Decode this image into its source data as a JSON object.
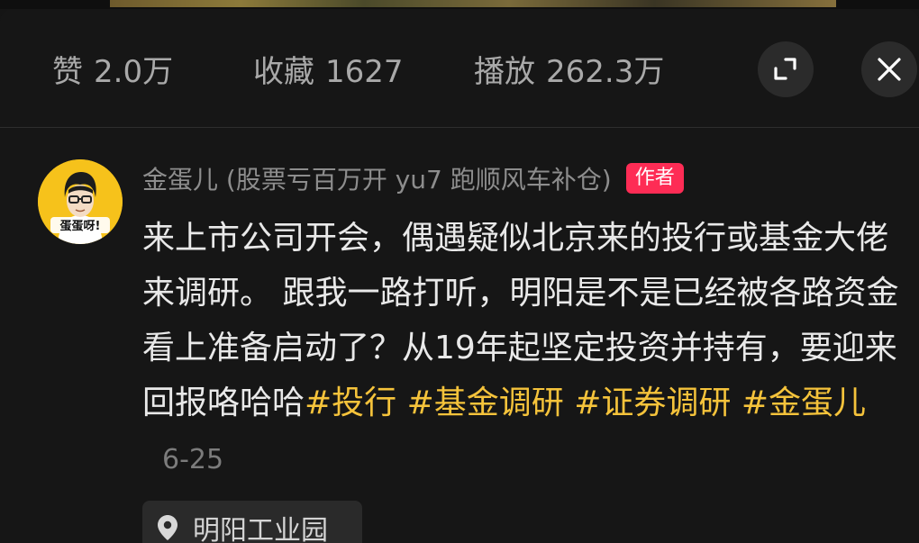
{
  "stats": {
    "likes_label": "赞",
    "likes_value": "2.0万",
    "favorites_label": "收藏",
    "favorites_value": "1627",
    "plays_label": "播放",
    "plays_value": "262.3万"
  },
  "controls": {
    "expand_icon": "expand-icon",
    "close_icon": "close-icon"
  },
  "comment": {
    "avatar_text": "蛋蛋呀!",
    "author_name": "金蛋儿 (股票亏百万开 yu7 跑顺风车补仓)",
    "author_badge": "作者",
    "body": "来上市公司开会，偶遇疑似北京来的投行或基金大佬来调研。 跟我一路打听，明阳是不是已经被各路资金看上准备启动了？从19年起坚定投资并持有，要迎来回报咯哈哈",
    "hashtags": [
      "#投行",
      "#基金调研",
      "#证券调研",
      "#金蛋儿"
    ],
    "date": "6-25",
    "location": "明阳工业园",
    "location_icon": "location-pin-icon"
  },
  "colors": {
    "background": "#161616",
    "hashtag": "#f5c33b",
    "badge": "#fe2c55",
    "muted_text": "#8d8d8d",
    "avatar_bg": "#f6c21b"
  }
}
